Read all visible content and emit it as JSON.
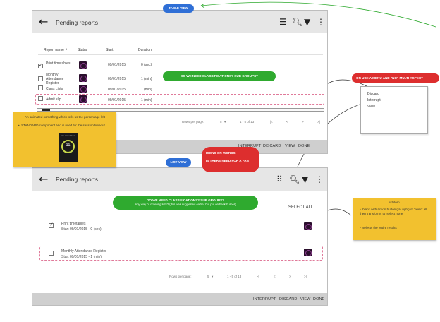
{
  "labels": {
    "table_view": "TABLE VIEW",
    "list_view": "LIST VIEW",
    "or_use_menu": "OR USE A MENU AND \"NO\" MULTI ASPECT",
    "need_class_1": "DO WE NEED CLASSIFICATIONS? SUB GROUPS?",
    "need_class_2_line1": "DO WE NEED CLASSIFICATIONS? SUB GROUPS?",
    "need_class_2_line2": "Any way of ordering lists? (this was suggested earlier but put on back burner)",
    "icons_or_words_line1": "ICONS OR WORDS",
    "icons_or_words_line2": "IS THERE NEED FOR A FAB"
  },
  "menu_items": [
    "Discard",
    "Interrupt",
    "View"
  ],
  "sticky_left": {
    "line1": "An animated something which tells us the percentage left",
    "bullet": "STANDARD component and is used for the session timeout",
    "gauge_number": "11",
    "gauge_caption": "min. timed have"
  },
  "sticky_right": {
    "heading": "list item",
    "bullet1": "blank with action button (far right) of 'select all' then transforms to 'select none'",
    "bullet2": "selects the entire results"
  },
  "table_screen": {
    "title": "Pending reports",
    "columns": [
      "Report name",
      "Status",
      "Start",
      "Duration"
    ],
    "rows": [
      {
        "name": "Print timetables",
        "start": "09/01/2015",
        "duration": "0 (sec)",
        "checked": true
      },
      {
        "name": "Monthly Attendance Register",
        "start": "09/01/2015",
        "duration": "1 (min)",
        "checked": false
      },
      {
        "name": "Class Lists",
        "start": "09/01/2015",
        "duration": "1 (min)",
        "checked": false
      },
      {
        "name": "Admit slip",
        "start": "09/01/2015",
        "duration": "1 (min)",
        "checked": false
      }
    ],
    "pager": {
      "rows_per_page": "Rows per page:",
      "per_page_value": "5",
      "range": "1 - 5 of 13"
    },
    "actions": [
      "INTERRUPT",
      "DISCARD",
      "VIEW",
      "DONE"
    ]
  },
  "list_screen": {
    "title": "Pending reports",
    "select_all": "SELECT ALL",
    "items": [
      {
        "name": "Print timetables",
        "sub": "Start 09/01/2015 - 0 (sec)",
        "checked": true
      },
      {
        "name": "Monthly Attendance Register",
        "sub": "Start 09/01/2015 - 1 (min)",
        "checked": false
      }
    ],
    "pager": {
      "rows_per_page": "Rows per page:",
      "per_page_value": "5",
      "range": "1 - 5 of 13"
    },
    "actions": [
      "INTERRUPT",
      "DISCARD",
      "VIEW",
      "DONE"
    ]
  },
  "colors": {
    "blue_pill": "#2f6fd6",
    "green_pill": "#2faa2f",
    "red_pill": "#dd2e2e",
    "sticky": "#f2c12f",
    "arrow_green": "#2faa2f",
    "dashed_highlight": "#e07a9a",
    "thumb_purple": "#2b0f2d"
  }
}
